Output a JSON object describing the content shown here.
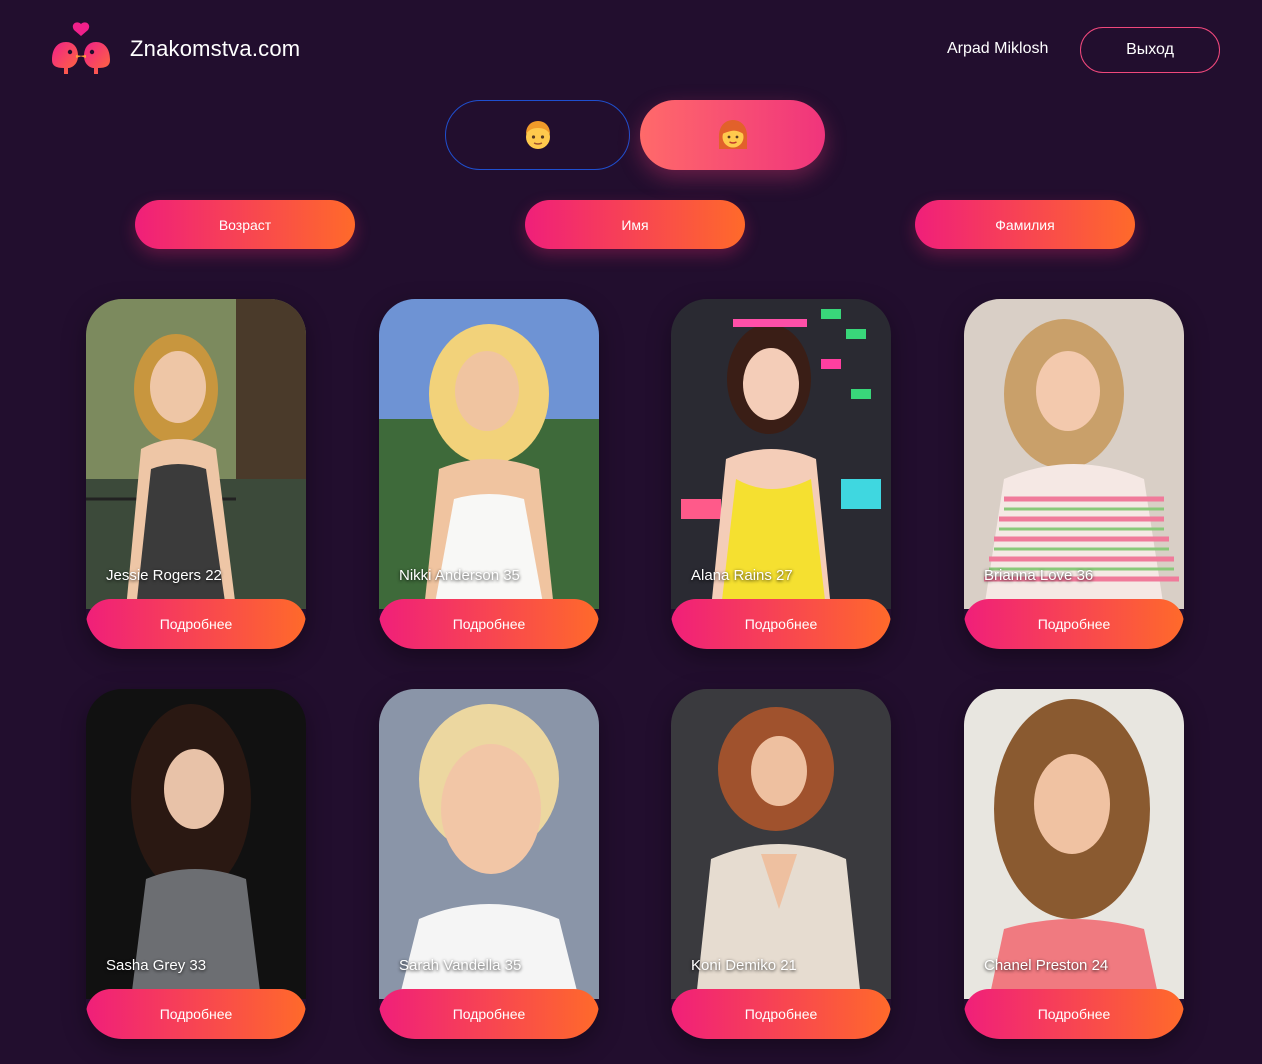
{
  "header": {
    "brand": "Znakomstva.com",
    "logo_icon": "two-birds-heart-logo",
    "username": "Arpad Miklosh",
    "logout_label": "Выход"
  },
  "gender_toggle": {
    "male_emoji": "👦",
    "female_emoji": "👩",
    "selected": "female"
  },
  "sort_buttons": [
    "Возраст",
    "Имя",
    "Фамилия"
  ],
  "colors": {
    "background": "#220e2e",
    "accent_gradient_start": "#f01f7a",
    "accent_gradient_end": "#ff6a2a",
    "male_outline": "#1f4fcf"
  },
  "profiles": [
    {
      "name": "Jessie Rogers",
      "age": "22",
      "caption": "Jessie Rogers 22",
      "button": "Подробнее"
    },
    {
      "name": "Nikki Anderson",
      "age": "35",
      "caption": "Nikki Anderson 35",
      "button": "Подробнее"
    },
    {
      "name": "Alana Rains",
      "age": "27",
      "caption": "Alana Rains 27",
      "button": "Подробнее"
    },
    {
      "name": "Brianna Love",
      "age": "36",
      "caption": "Brianna Love 36",
      "button": "Подробнее"
    },
    {
      "name": "Sasha Grey",
      "age": "33",
      "caption": "Sasha Grey 33",
      "button": "Подробнее"
    },
    {
      "name": "Sarah Vandella",
      "age": "35",
      "caption": "Sarah Vandella 35",
      "button": "Подробнее"
    },
    {
      "name": "Koni Demiko",
      "age": "21",
      "caption": "Koni Demiko 21",
      "button": "Подробнее"
    },
    {
      "name": "Chanel Preston",
      "age": "24",
      "caption": "Chanel Preston 24",
      "button": "Подробнее"
    }
  ]
}
